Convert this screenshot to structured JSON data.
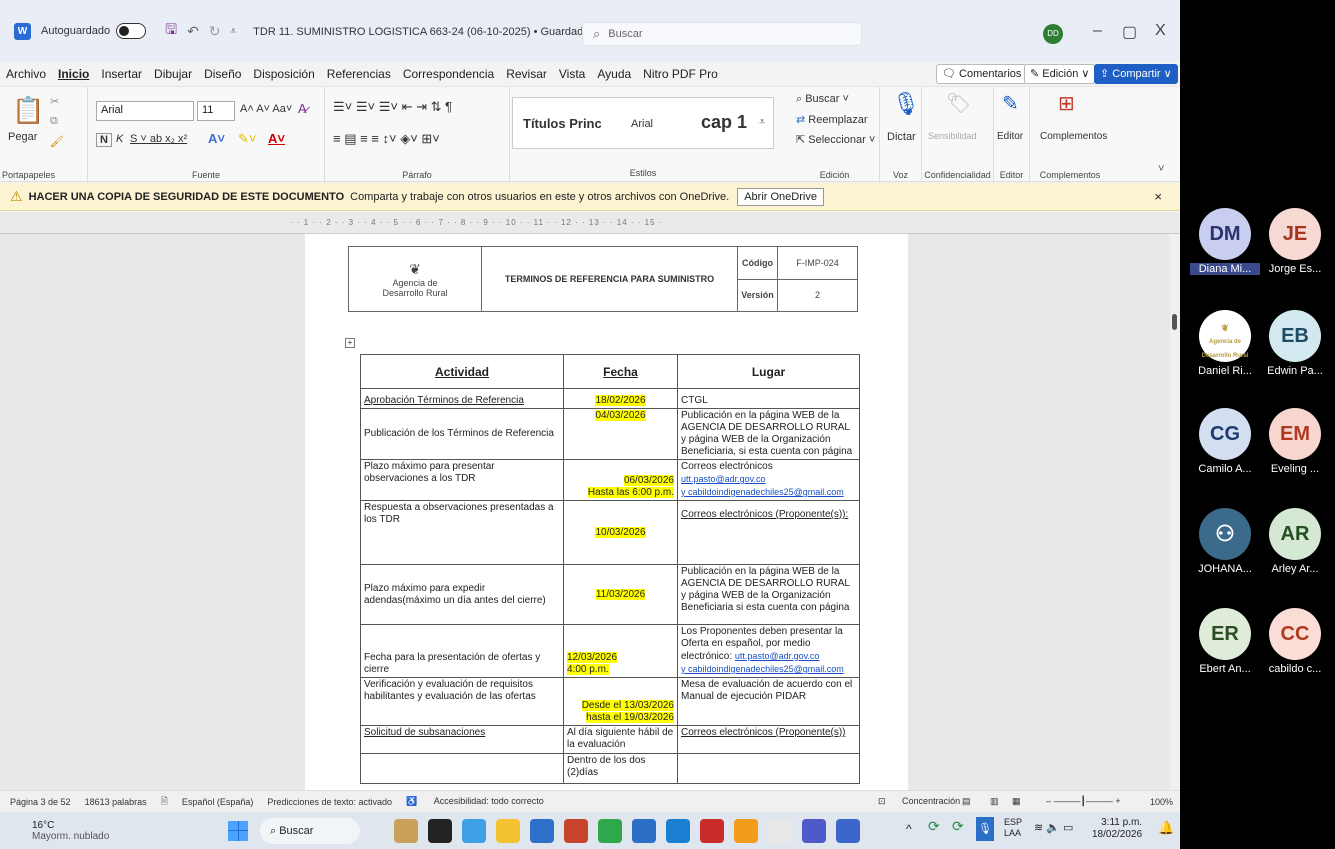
{
  "titlebar": {
    "autosave_label": "Autoguardado",
    "document_title": "TDR 11. SUMINISTRO LOGISTICA 663-24 (06-10-2025) • Guardado ∨",
    "search_placeholder": "Buscar",
    "avatar_initials": "DD",
    "minimize": "–",
    "restore": "▢",
    "close": "X"
  },
  "menu": {
    "items": [
      "Archivo",
      "Inicio",
      "Insertar",
      "Dibujar",
      "Diseño",
      "Disposición",
      "Referencias",
      "Correspondencia",
      "Revisar",
      "Vista",
      "Ayuda",
      "Nitro PDF Pro"
    ],
    "active": "Inicio",
    "comments": "Comentarios",
    "edit_mode": "Edición ∨",
    "share": "Compartir ∨"
  },
  "ribbon": {
    "clipboard": {
      "paste": "Pegar",
      "label": "Portapapeles"
    },
    "font": {
      "name": "Arial",
      "size": "11",
      "label": "Fuente"
    },
    "paragraph": {
      "label": "Párrafo"
    },
    "styles": {
      "items": [
        "Títulos Princ",
        "Arial",
        "cap 1"
      ],
      "label": "Estilos"
    },
    "editing": {
      "find": "Buscar",
      "replace": "Reemplazar",
      "select": "Seleccionar",
      "label": "Edición"
    },
    "voice": {
      "dictate": "Dictar",
      "label": "Voz"
    },
    "sensitivity": {
      "button": "Sensibilidad",
      "label": "Confidencialidad"
    },
    "editor": {
      "button": "Editor",
      "label": "Editor"
    },
    "addins": {
      "button": "Complementos",
      "label": "Complementos"
    }
  },
  "notice": {
    "bold": "HACER UNA COPIA DE SEGURIDAD DE ESTE DOCUMENTO",
    "text": "Comparta y trabaje con otros usuarios en este y otros archivos con OneDrive.",
    "button": "Abrir OneDrive"
  },
  "ruler": "· · 1 · · 2 · · 3 · · 4 · · 5 · · 6 · · 7 · · 8 · · 9 · · 10 · · 11 · · 12 · · 13 · · 14 · · 15 ·",
  "doc_header": {
    "logo_line1": "Agencia de",
    "logo_line2": "Desarrollo Rural",
    "title": "TERMINOS DE REFERENCIA PARA SUMINISTRO",
    "code_label": "Código",
    "code_value": "F-IMP-024",
    "version_label": "Versión",
    "version_value": "2"
  },
  "table": {
    "headers": [
      "Actividad",
      "Fecha",
      "Lugar"
    ],
    "rows": [
      {
        "actividad": "Aprobación Términos de Referencia",
        "fecha": "18/02/2026",
        "lugar": "CTGL"
      },
      {
        "actividad": "Publicación de los Términos de Referencia",
        "fecha": "04/03/2026",
        "lugar": "Publicación en la página WEB de la AGENCIA DE DESARROLLO RURAL y página WEB de la Organización Beneficiaria, si esta cuenta con página"
      },
      {
        "actividad": "Plazo máximo para presentar observaciones a los TDR",
        "fecha": "06/03/2026",
        "fecha2": "Hasta las 6:00 p.m.",
        "lugar": "Correos electrónicos",
        "link1": "utt.pasto@adr.gov.co",
        "link2": "y cabildoindigenadechiles25@gmail.com"
      },
      {
        "actividad": "Respuesta a observaciones presentadas a los TDR",
        "fecha": "10/03/2026",
        "lugar": "Correos electrónicos (Proponente(s)):"
      },
      {
        "actividad": "Plazo máximo para expedir adendas(máximo un día antes del cierre)",
        "fecha": "11/03/2026",
        "lugar": "Publicación en la página WEB de la AGENCIA DE DESARROLLO RURAL y página WEB de la Organización Beneficiaria si esta cuenta con página"
      },
      {
        "actividad": "Fecha para la presentación de ofertas y cierre",
        "fecha": "12/03/2026",
        "fecha2": "4:00 p.m.",
        "lugar": "Los Proponentes deben presentar la Oferta en español, por medio electrónico:",
        "link1": "utt.pasto@adr.gov.co",
        "link2": "y cabildoindigenadechiles25@gmail.com"
      },
      {
        "actividad": "Verificación y evaluación de requisitos habilitantes y evaluación de las ofertas",
        "fecha": "Desde el 13/03/2026",
        "fecha2": "hasta el 19/03/2026",
        "lugar": "Mesa de evaluación de acuerdo con el Manual de ejecución PIDAR"
      },
      {
        "actividad": "Solicitud de subsanaciones",
        "fecha": "Al día siguiente hábil de la evaluación",
        "lugar": "Correos electrónicos (Proponente(s))"
      },
      {
        "actividad": "",
        "fecha": "Dentro de los dos (2)días",
        "lugar": ""
      }
    ]
  },
  "status": {
    "page": "Página 3 de 52",
    "words": "18613 palabras",
    "language": "Español (España)",
    "predictions": "Predicciones de texto: activado",
    "accessibility": "Accesibilidad: todo correcto",
    "focus": "Concentración",
    "zoom": "100%"
  },
  "taskbar": {
    "weather_temp": "16°C",
    "weather_desc": "Mayorm. nublado",
    "search": "Buscar",
    "lang1": "ESP",
    "lang2": "LAA",
    "time": "3:11 p.m.",
    "date": "18/02/2026"
  },
  "participants": [
    {
      "initials": "DM",
      "name": "Diana Mi...",
      "bg": "#c9cdf0",
      "fg": "#2c3470"
    },
    {
      "initials": "JE",
      "name": "Jorge Es...",
      "bg": "#f7d9d3",
      "fg": "#a8351f"
    },
    {
      "initials": "",
      "name": "Daniel Ri...",
      "bg": "#ffffff",
      "fg": "#b89a3c"
    },
    {
      "initials": "EB",
      "name": "Edwin Pa...",
      "bg": "#d3e9f2",
      "fg": "#1f4d66"
    },
    {
      "initials": "CG",
      "name": "Camilo A...",
      "bg": "#d3dff0",
      "fg": "#1f3c70"
    },
    {
      "initials": "EM",
      "name": "Eveling ...",
      "bg": "#f7d6cf",
      "fg": "#b03a20"
    },
    {
      "initials": "",
      "name": "JOHANA...",
      "bg": "#3b6a8a",
      "fg": "#ffffff"
    },
    {
      "initials": "AR",
      "name": "Arley Ar...",
      "bg": "#d5e8d4",
      "fg": "#234d22"
    },
    {
      "initials": "ER",
      "name": "Ebert An...",
      "bg": "#dfecd9",
      "fg": "#2c4d26"
    },
    {
      "initials": "CC",
      "name": "cabildo c...",
      "bg": "#f9ddd6",
      "fg": "#b03a20"
    }
  ]
}
